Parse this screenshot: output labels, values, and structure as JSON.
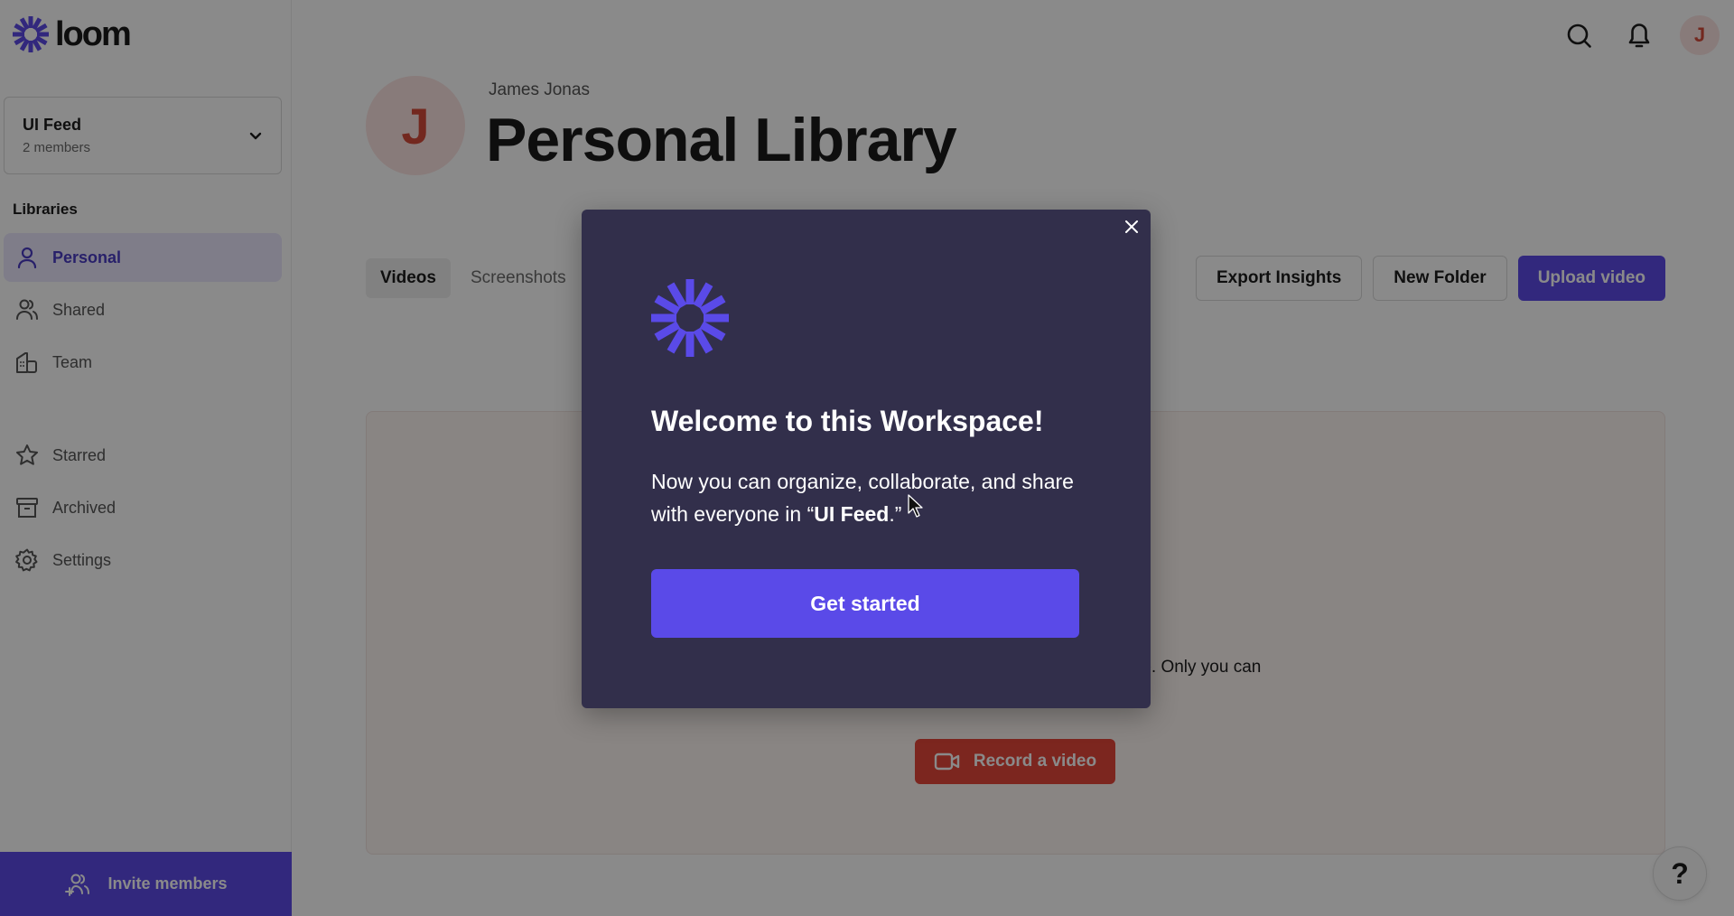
{
  "app": {
    "name": "loom",
    "brand_color": "#5d4be8"
  },
  "sidebar": {
    "workspace": {
      "name": "UI Feed",
      "members": "2 members"
    },
    "section_label": "Libraries",
    "items": [
      {
        "label": "Personal",
        "icon": "person-icon",
        "active": true
      },
      {
        "label": "Shared",
        "icon": "users-icon",
        "active": false
      },
      {
        "label": "Team",
        "icon": "building-icon",
        "active": false
      },
      {
        "label": "Starred",
        "icon": "star-icon",
        "active": false
      },
      {
        "label": "Archived",
        "icon": "archive-icon",
        "active": false
      },
      {
        "label": "Settings",
        "icon": "gear-icon",
        "active": false
      }
    ],
    "invite_label": "Invite members"
  },
  "topbar": {
    "icons": [
      "search-icon",
      "bell-icon"
    ],
    "avatar_initial": "J"
  },
  "header": {
    "avatar_initial": "J",
    "owner_name": "James Jonas",
    "title": "Personal Library"
  },
  "tabs": [
    {
      "label": "Videos",
      "active": true
    },
    {
      "label": "Screenshots",
      "active": false
    }
  ],
  "actions": {
    "export": "Export Insights",
    "new_folder": "New Folder",
    "upload": "Upload video"
  },
  "empty_state": {
    "partial_text": "re. Only you can",
    "record_label": "Record a video"
  },
  "help": {
    "label": "?"
  },
  "modal": {
    "title": "Welcome to this Workspace!",
    "body_prefix": "Now you can organize, collaborate, and share with everyone in “",
    "body_workspace": "UI Feed",
    "body_suffix": ".”",
    "cta": "Get started",
    "close_icon": "close-icon"
  }
}
